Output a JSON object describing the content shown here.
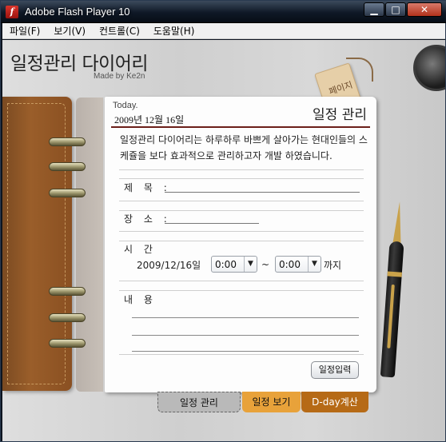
{
  "window": {
    "title": "Adobe Flash Player 10",
    "icon": "flash-app-icon",
    "controls": {
      "minimize": "▁",
      "maximize": "□",
      "close": "✕"
    }
  },
  "menu": [
    "파일(F)",
    "보기(V)",
    "컨트롤(C)",
    "도움말(H)"
  ],
  "app": {
    "title": "일정관리 다이어리",
    "credit": "Made by Ke2n",
    "tag_text": "페이지"
  },
  "diary": {
    "today_label": "Today.",
    "date": "2009년 12월 16일",
    "heading": "일정 관리",
    "intro": "일정관리 다이어리는 하루하루 바쁘게 살아가는 현대인들의 스케쥴을 보다 효과적으로 관리하고자 개발 하였습니다.",
    "fields": {
      "title_label": "제 목 :",
      "place_label": "장 소 :",
      "time_label": "시 간",
      "content_label": "내 용"
    },
    "time": {
      "date": "2009/12/16일",
      "start": "0:00",
      "end": "0:00",
      "separator": "~",
      "until": "까지"
    },
    "submit_label": "일정입력"
  },
  "tabs": [
    "일정 관리",
    "일정 보기",
    "D-day계산"
  ]
}
